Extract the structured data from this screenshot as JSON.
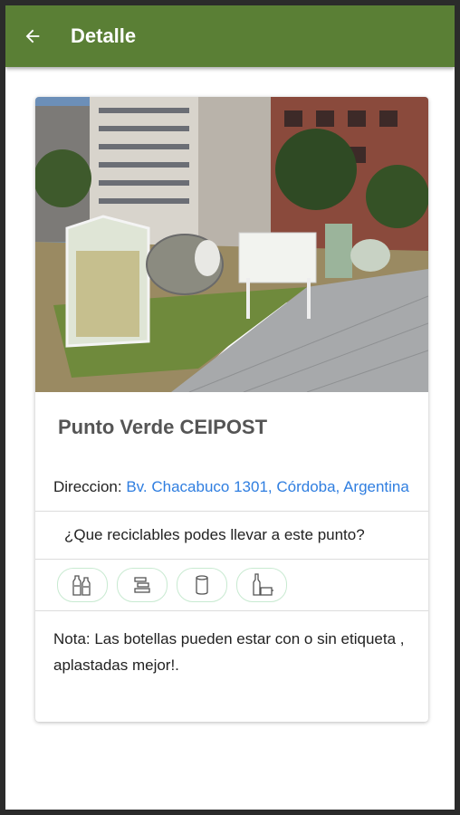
{
  "appbar": {
    "title": "Detalle",
    "back_icon": "arrow-left-icon"
  },
  "place": {
    "name": "Punto Verde CEIPOST",
    "address_label": "Direccion:",
    "address_value": "Bv. Chacabuco 1301, Córdoba, Argentina",
    "question": "¿Que reciclables podes llevar a este punto?",
    "recyclables": [
      {
        "icon": "plastic-bottles-icon"
      },
      {
        "icon": "paper-stack-icon"
      },
      {
        "icon": "can-icon"
      },
      {
        "icon": "glass-bottles-icon"
      }
    ],
    "note": "Nota: Las botellas pueden estar con o sin etiqueta , aplastadas mejor!."
  },
  "colors": {
    "appbar": "#5a7f35",
    "link": "#2f7ee0",
    "chip_border": "#c8ead1"
  }
}
